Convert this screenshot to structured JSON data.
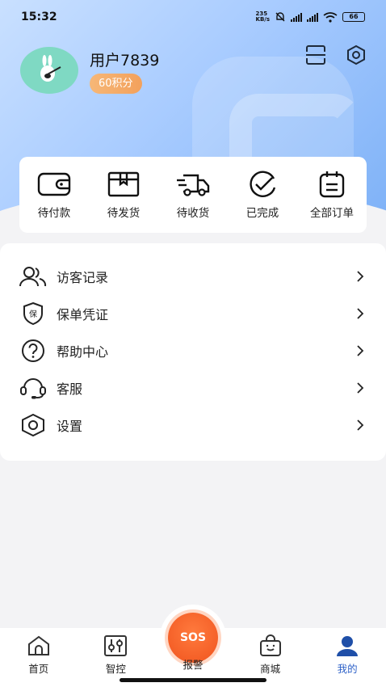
{
  "status": {
    "time": "15:32",
    "net_speed_top": "235",
    "net_speed_bottom": "KB/s",
    "battery": "66"
  },
  "profile": {
    "username": "用户7839",
    "points": "60积分"
  },
  "orders": [
    {
      "label": "待付款",
      "icon": "wallet-icon"
    },
    {
      "label": "待发货",
      "icon": "box-icon"
    },
    {
      "label": "待收货",
      "icon": "truck-icon"
    },
    {
      "label": "已完成",
      "icon": "check-circle-icon"
    },
    {
      "label": "全部订单",
      "icon": "clipboard-icon"
    }
  ],
  "menu": [
    {
      "label": "访客记录",
      "icon": "visitors-icon"
    },
    {
      "label": "保单凭证",
      "icon": "insurance-shield-icon"
    },
    {
      "label": "帮助中心",
      "icon": "help-icon"
    },
    {
      "label": "客服",
      "icon": "headset-icon"
    },
    {
      "label": "设置",
      "icon": "settings-icon"
    }
  ],
  "nav": {
    "home": "首页",
    "control": "智控",
    "sos_text": "SOS",
    "alarm": "报警",
    "mall": "商城",
    "mine": "我的"
  },
  "colors": {
    "accent": "#2f62c8",
    "sos": "#f0541e",
    "points_badge": "#f3a15c"
  }
}
